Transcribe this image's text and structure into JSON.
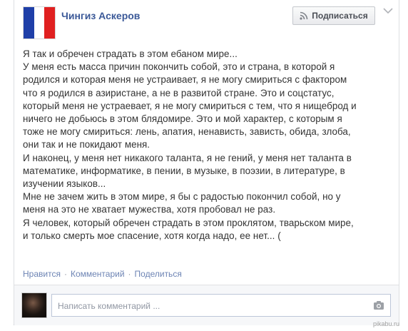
{
  "post": {
    "author": "Чингиз Аскеров",
    "follow_label": "Подписаться",
    "text_lines": [
      "Я так и обречен страдать в этом ебаном мире...",
      "У меня есть масса причин покончить собой, это и страна, в которой я",
      "родился и которая меня не устраивает, я не могу смириться с фактором",
      "что я родился в азиристане, а не в развитой стране. Это и соцстатус,",
      "который меня не устраевает, я не могу смириться с тем, что я нищеброд и",
      "ничего не добьюсь в этом блядомире. Это и мой характер, с которым я",
      "тоже не могу смириться: лень, апатия, ненависть, зависть, обида, злоба,",
      "они так и не покидают меня.",
      "И наконец, у меня нет никакого таланта, я не гений, у меня нет таланта в",
      "математике, информатике, в пении, в музыке, в поэзии, в литературе, в",
      "изучении языков...",
      "Мне не зачем жить в этом мире, я бы с радостью покончил собой, но у",
      "меня на это не хватает мужества, хотя пробовал не раз.",
      "Я человек, который обречен страдать в этом проклятом, тварьском мире,",
      "и только смерть мое спасение, хотя когда надо, ее нет... ("
    ]
  },
  "actions": {
    "like": "Нравится",
    "comment": "Комментарий",
    "share": "Поделиться",
    "separator": "·"
  },
  "comment_box": {
    "placeholder": "Написать комментарий ..."
  },
  "watermark": "pikabu.ru",
  "colors": {
    "link": "#3b5998",
    "action_link": "#6d84b4",
    "text": "#333333",
    "flag_blue": "#1f3fa8",
    "flag_red": "#e02020"
  },
  "icons": [
    "rss-icon",
    "chevron-down-icon",
    "camera-icon"
  ]
}
